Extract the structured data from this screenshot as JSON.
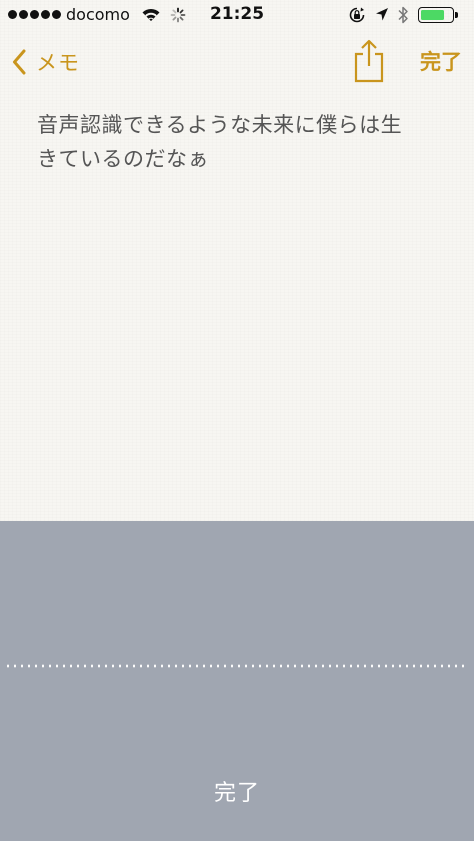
{
  "status_bar": {
    "carrier": "docomo",
    "time": "21:25",
    "signal_bars": 5,
    "battery_level": 0.8,
    "battery_color": "#4cd964"
  },
  "nav": {
    "back_label": "メモ",
    "done_label": "完了",
    "accent_color": "#c9951d"
  },
  "note": {
    "text": "音声認識できるような未来に僕らは生\nきているのだなぁ"
  },
  "dictation": {
    "done_label": "完了",
    "panel_color": "#a0a6b1"
  },
  "icons": {
    "back": "chevron-left-icon",
    "share": "share-icon",
    "wifi": "wifi-icon",
    "activity": "activity-spinner-icon",
    "rotation_lock": "rotation-lock-icon",
    "location": "location-arrow-icon",
    "bluetooth": "bluetooth-icon",
    "battery": "battery-icon"
  }
}
